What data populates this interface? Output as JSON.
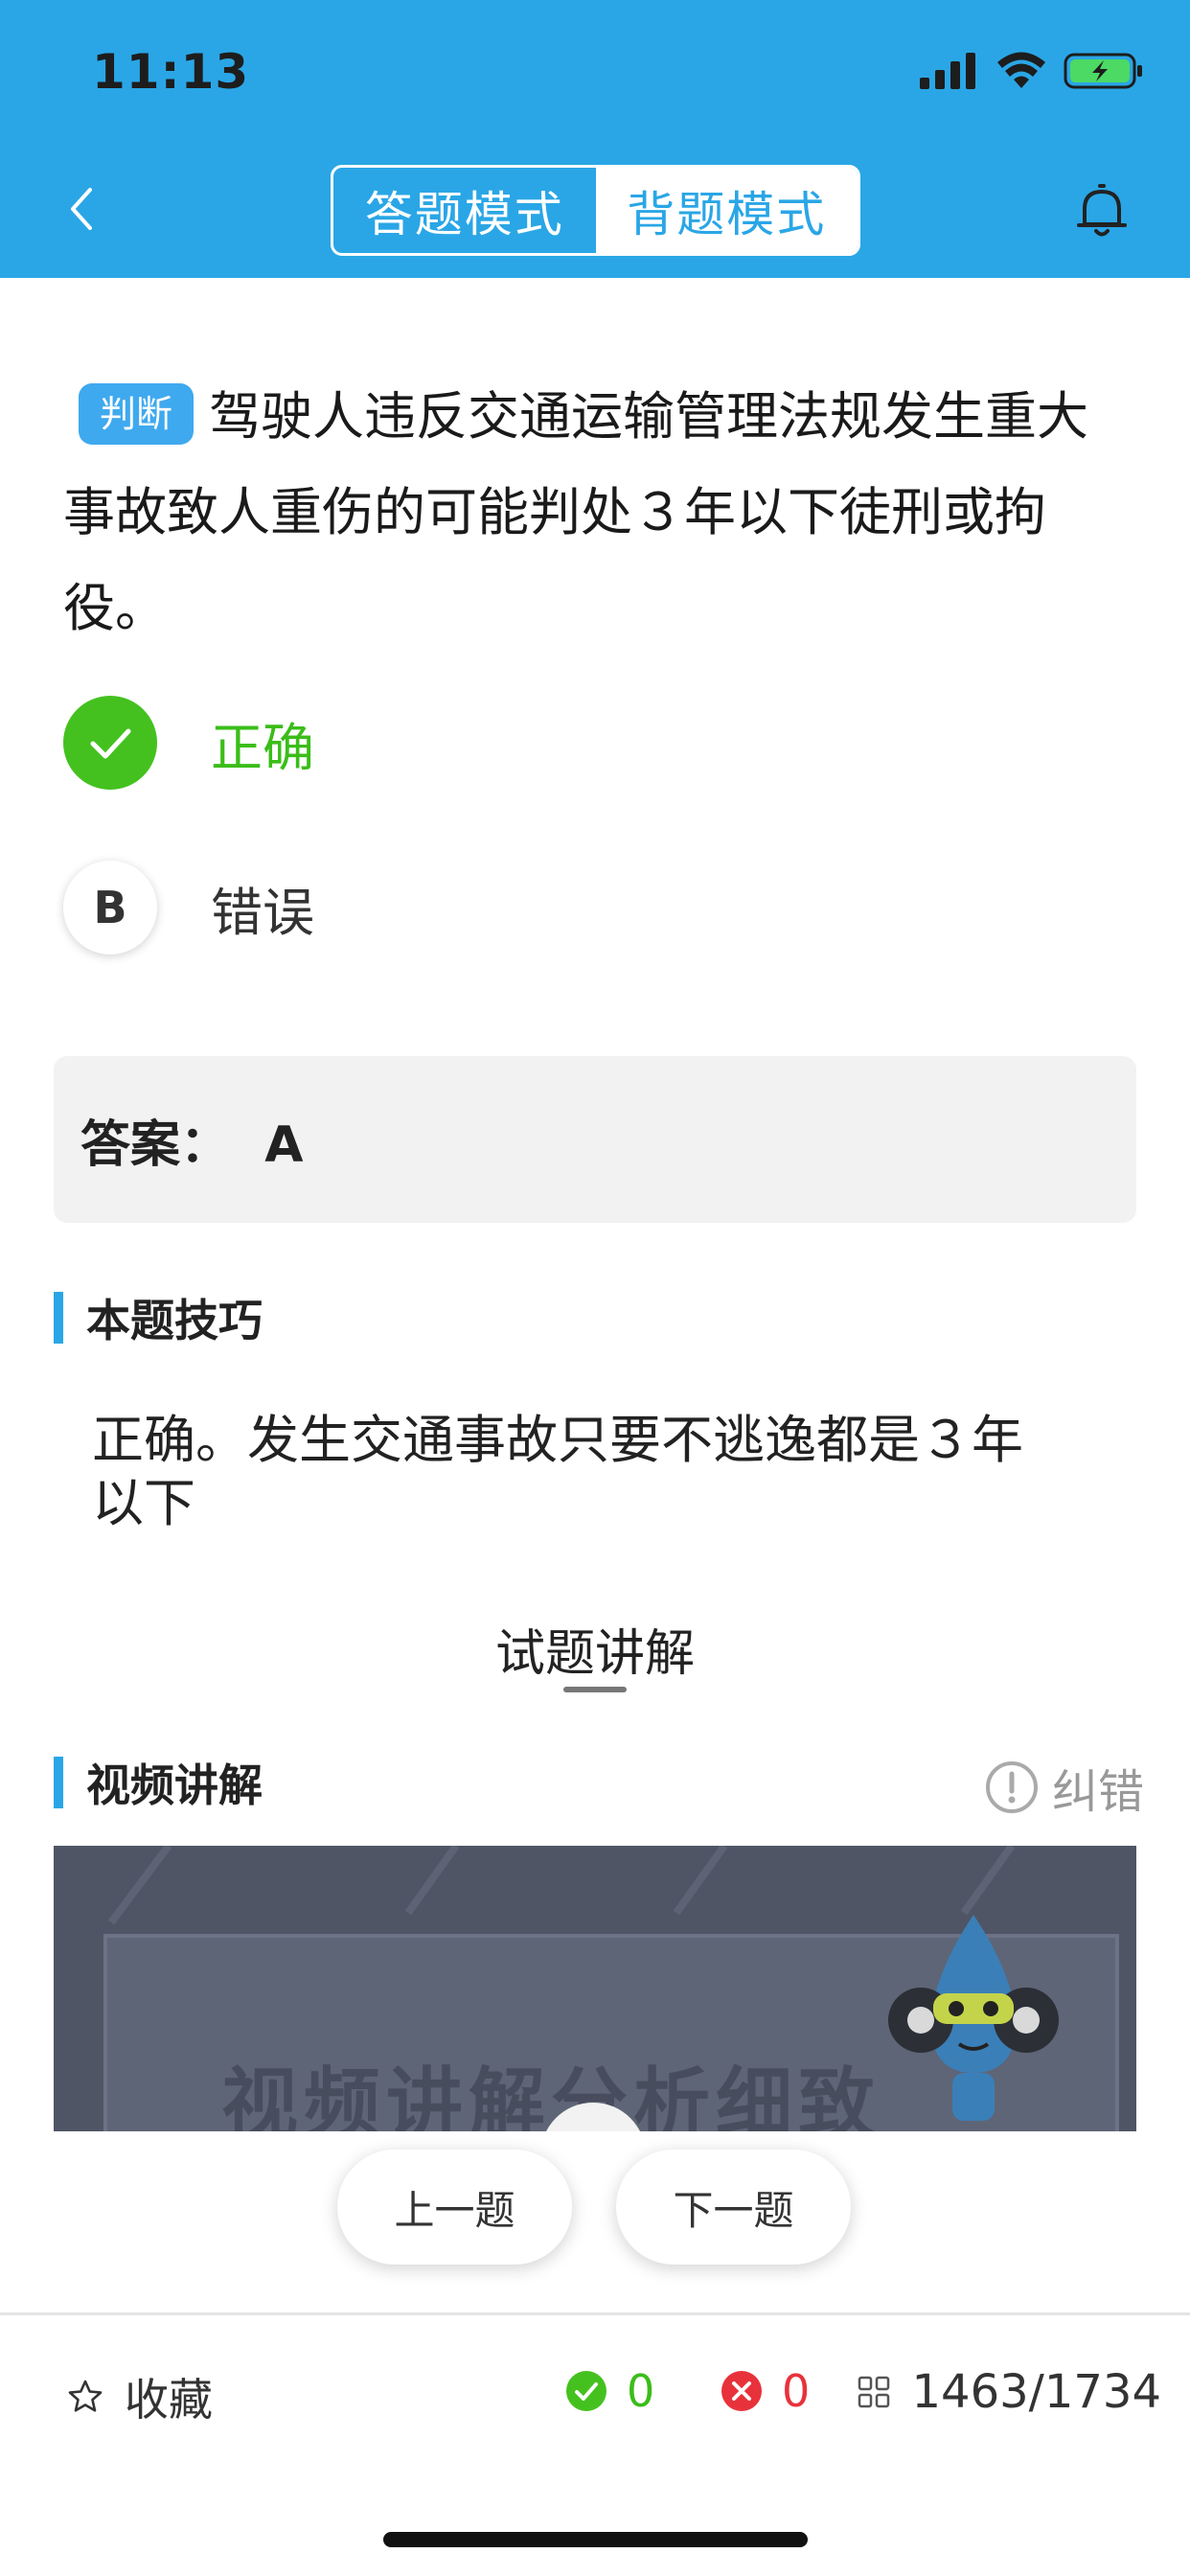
{
  "status_bar": {
    "time": "11:13"
  },
  "header": {
    "mode_tabs": [
      {
        "label": "答题模式",
        "active": false
      },
      {
        "label": "背题模式",
        "active": true
      }
    ],
    "accent_color": "#2aa6e6"
  },
  "question": {
    "type_tag": "判断",
    "text": "驾驶人违反交通运输管理法规发生重大事故致人重伤的可能判处３年以下徒刑或拘役。",
    "options": [
      {
        "letter": "A",
        "label": "正确",
        "state": "correct"
      },
      {
        "letter": "B",
        "label": "错误",
        "state": "unselected"
      }
    ]
  },
  "answer": {
    "text": "答案：  A"
  },
  "tip_section": {
    "title": "本题技巧",
    "content": "正确。发生交通事故只要不逃逸都是３年以下"
  },
  "lecture_tab": {
    "label": "试题讲解"
  },
  "video_section": {
    "title": "视频讲解",
    "report_label": "纠错",
    "video_caption": "视频讲解分析细致"
  },
  "nav": {
    "prev_label": "上一题",
    "next_label": "下一题"
  },
  "bottom_bar": {
    "favorite_label": "收藏",
    "correct_count": "0",
    "wrong_count": "0",
    "progress": "1463/1734"
  },
  "colors": {
    "correct": "#44c11f",
    "wrong": "#e8323b",
    "tag": "#3fa9ef"
  }
}
